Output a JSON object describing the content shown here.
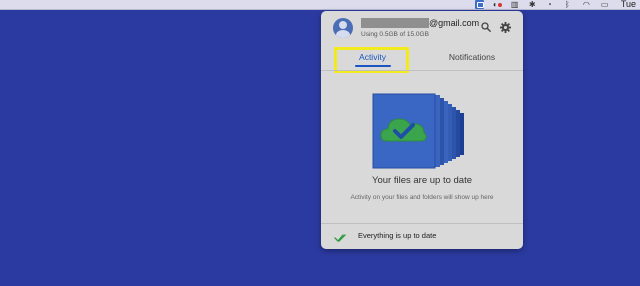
{
  "menubar": {
    "icons": [
      "google-drive-icon",
      "record-icon",
      "document-icon",
      "bluetooth-icon",
      "time-machine-icon",
      "bluetooth-icon",
      "wifi-icon",
      "mirroring-icon"
    ],
    "clock": "Tue"
  },
  "panel": {
    "account": {
      "email_suffix": "@gmail.com",
      "usage": "Using 0.5GB of 15.0GB"
    },
    "tabs": [
      {
        "label": "Activity",
        "active": true
      },
      {
        "label": "Notifications",
        "active": false
      }
    ],
    "status": {
      "title": "Your files are up to date",
      "subtitle": "Activity on your files and folders will show up here"
    },
    "footer": {
      "text": "Everything is up to date"
    }
  },
  "colors": {
    "desktop": "#2b3aa0",
    "panel": "#d9d9d9",
    "accent": "#1a55c2",
    "highlight": "#f2ea1c",
    "check": "#2e9a3f"
  }
}
